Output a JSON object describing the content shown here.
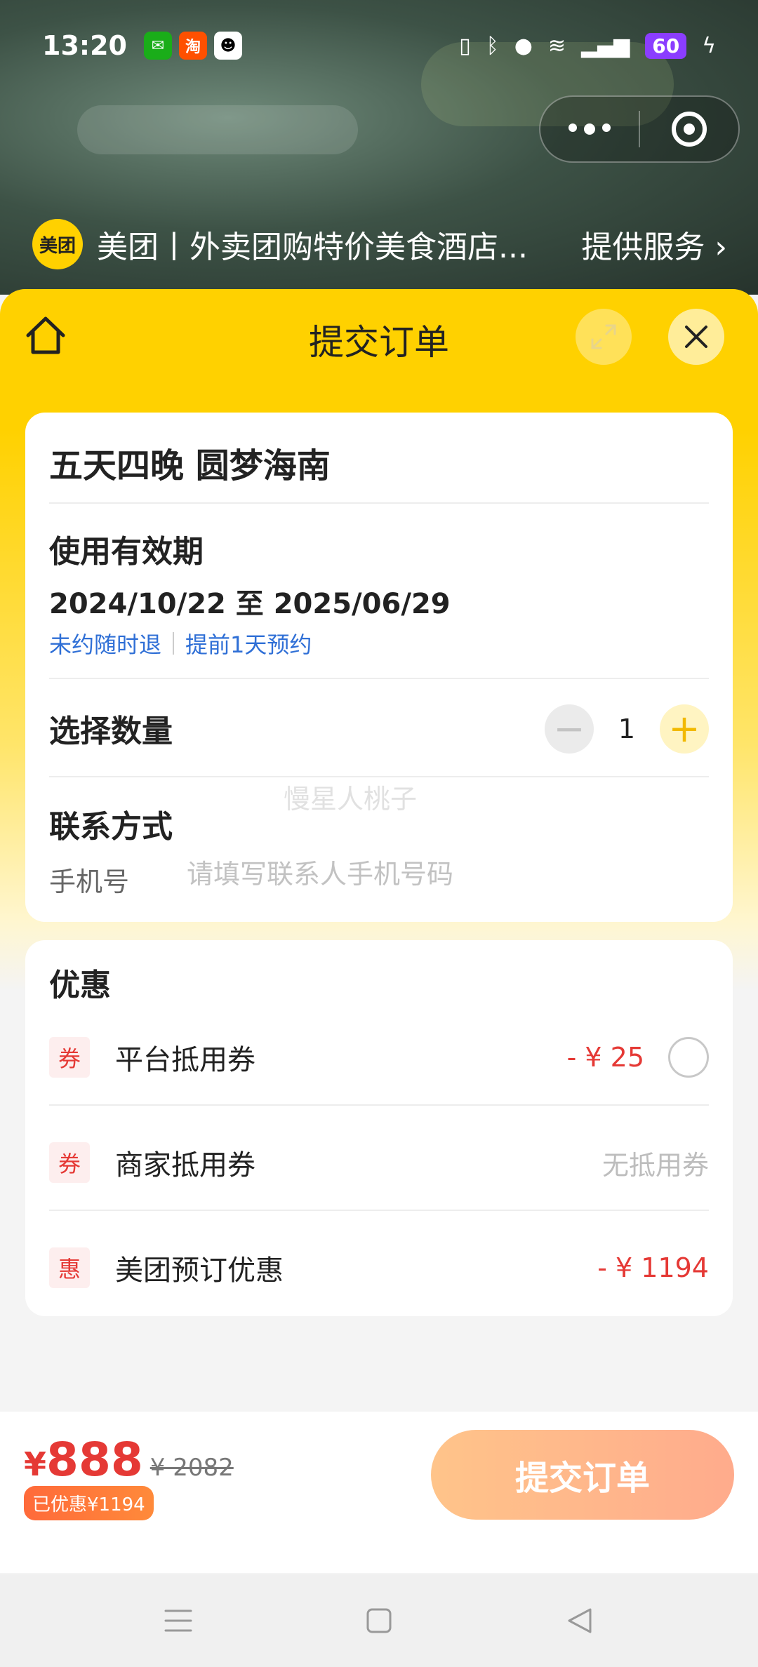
{
  "status_bar": {
    "time": "13:20",
    "apps": [
      "wechat-icon",
      "taobao-icon",
      "qq-icon"
    ],
    "battery": "60"
  },
  "mini_program": {
    "logo_text": "美团",
    "title": "美团丨外卖团购特价美食酒店...",
    "service_link": "提供服务 ›"
  },
  "sheet": {
    "title": "提交订单"
  },
  "product": {
    "name": "五天四晚 圆梦海南",
    "validity_label": "使用有效期",
    "validity_dates": "2024/10/22 至 2025/06/29",
    "tags": [
      "未约随时退",
      "提前1天预约"
    ]
  },
  "quantity": {
    "label": "选择数量",
    "value": "1",
    "minus": "−",
    "plus": "+"
  },
  "contact": {
    "label": "联系方式",
    "phone_label": "手机号",
    "phone_placeholder": "请填写联系人手机号码",
    "phone_value": ""
  },
  "watermark": "慢星人桃子",
  "discounts": {
    "title": "优惠",
    "items": [
      {
        "badge": "券",
        "label": "平台抵用券",
        "value": "- ¥ 25",
        "selectable": true
      },
      {
        "badge": "券",
        "label": "商家抵用券",
        "value": "无抵用券",
        "selectable": false
      },
      {
        "badge": "惠",
        "label": "美团预订优惠",
        "value": "- ¥ 1194",
        "selectable": false
      }
    ]
  },
  "footer": {
    "currency": "¥",
    "price": "888",
    "original_price": "¥ 2082",
    "saved": "已优惠¥1194",
    "submit_label": "提交订单"
  },
  "colors": {
    "brand_yellow": "#ffd100",
    "price_red": "#e53935",
    "link_blue": "#2f6fd6"
  }
}
